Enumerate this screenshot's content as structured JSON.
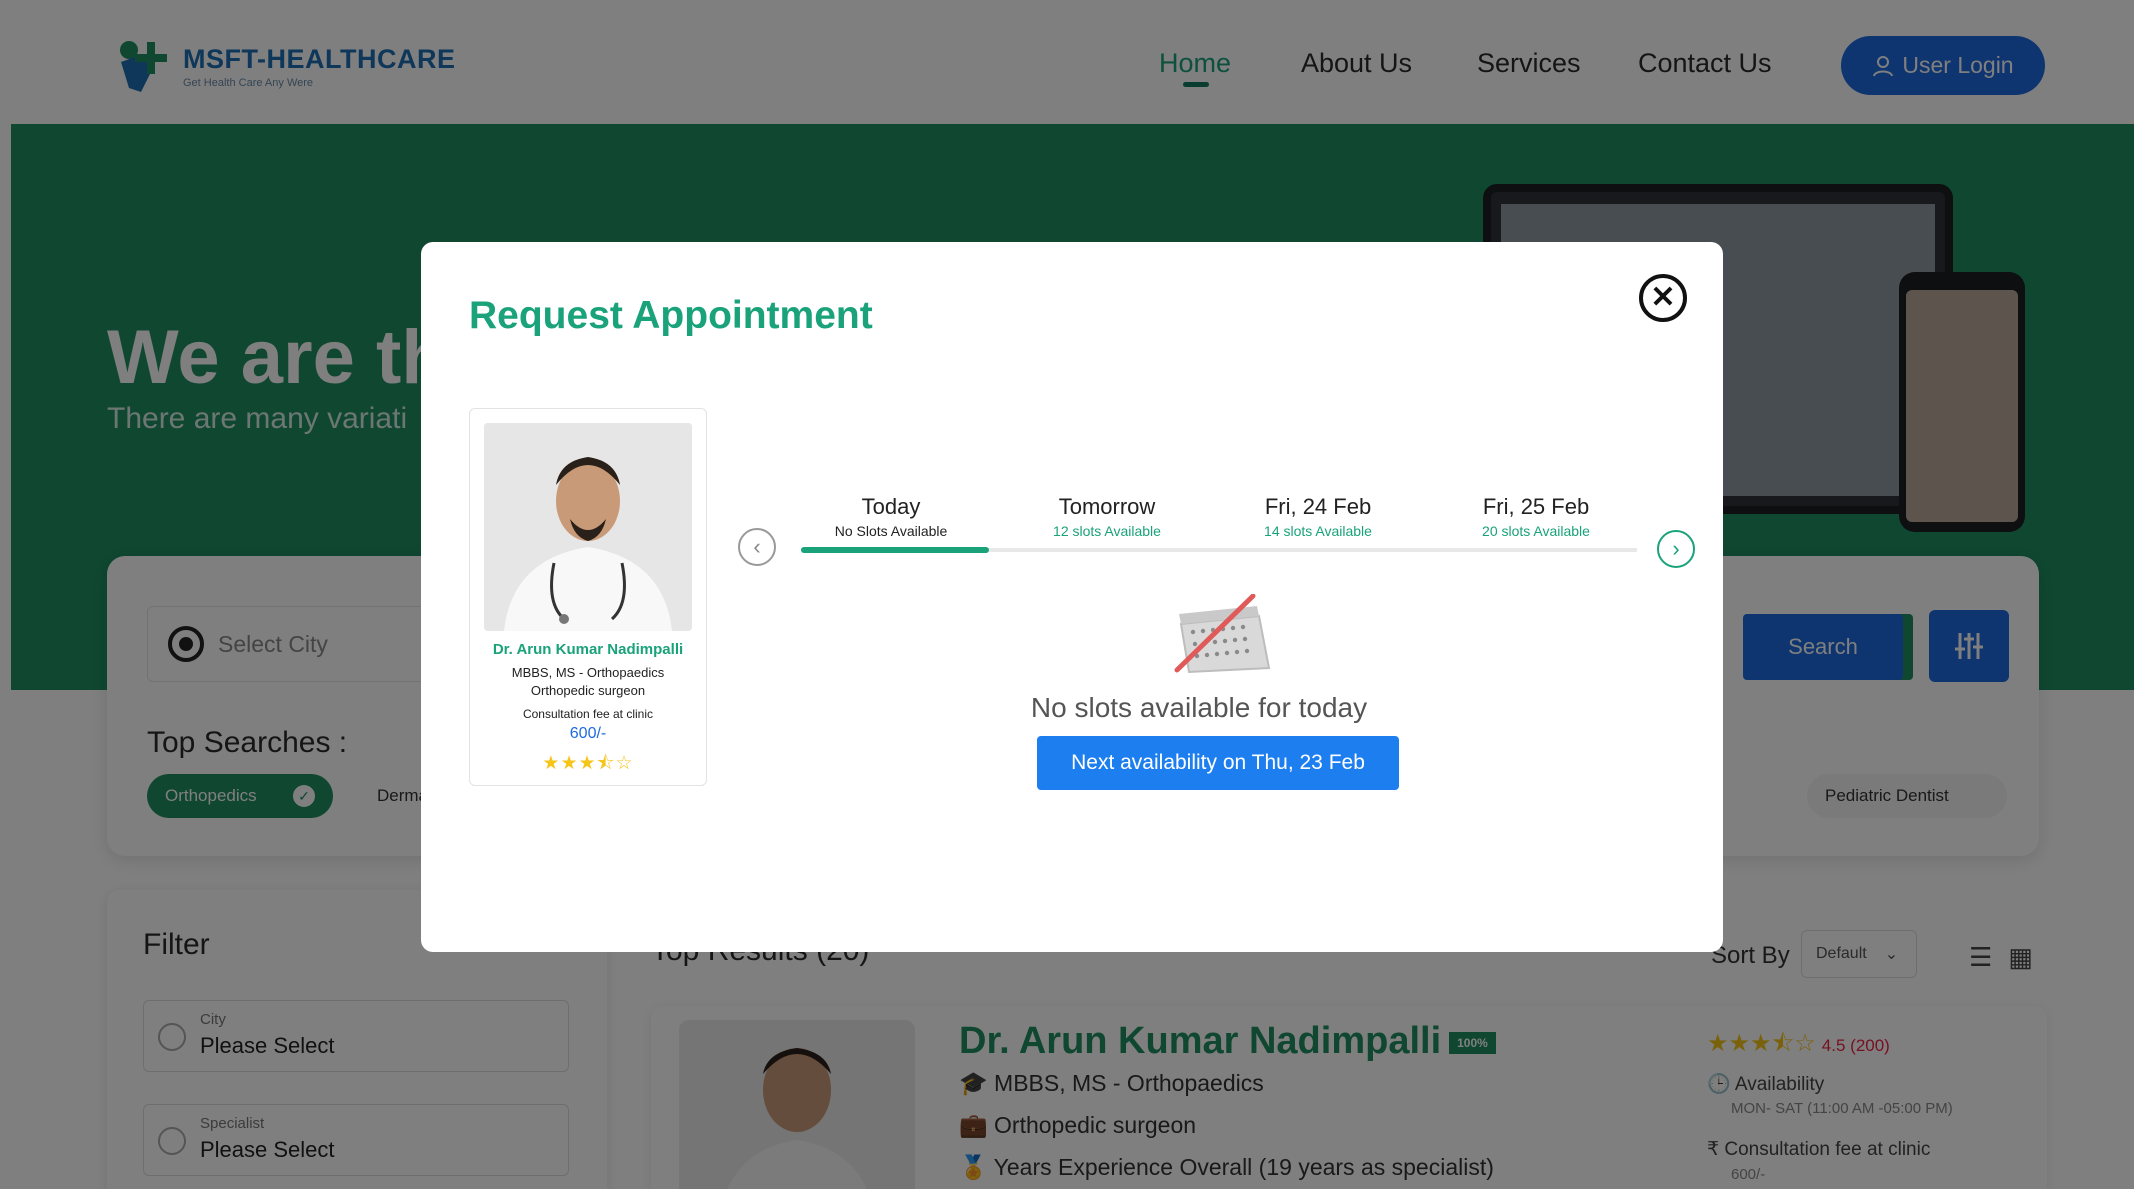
{
  "site": {
    "logo_title": "MSFT-HEALTHCARE",
    "logo_tagline": "Get Health Care Any Were",
    "nav": [
      "Home",
      "About Us",
      "Services",
      "Contact Us"
    ],
    "active_nav": "Home",
    "login_label": "User Login"
  },
  "hero": {
    "title": "We are th",
    "subtitle": "There are many variati"
  },
  "search": {
    "city_placeholder": "Select City",
    "search_label": "Search",
    "top_searches_label": "Top Searches :",
    "chips": [
      "Orthopedics",
      "Derma",
      "Pediatric Dentist"
    ]
  },
  "filter": {
    "title": "Filter",
    "fields": [
      {
        "label": "City",
        "value": "Please Select"
      },
      {
        "label": "Specialist",
        "value": "Please Select"
      }
    ]
  },
  "results": {
    "title": "Top Results (20)",
    "sort_by_label": "Sort By",
    "sort_value": "Default",
    "card": {
      "name": "Dr. Arun Kumar Nadimpalli",
      "badge": "100%",
      "degree": "MBBS, MS - Orthopaedics",
      "role": "Orthopedic surgeon",
      "experience": "Years Experience Overall (19 years as specialist)",
      "rating": "4.5 (200)",
      "availability_label": "Availability",
      "availability_value": "MON- SAT (11:00 AM -05:00 PM)",
      "fee_label": "Consultation fee at clinic",
      "fee_value": "600/-"
    }
  },
  "modal": {
    "title": "Request Appointment",
    "doctor": {
      "name": "Dr. Arun Kumar Nadimpalli",
      "degree": "MBBS, MS - Orthopaedics",
      "role": "Orthopedic surgeon",
      "fee_label": "Consultation fee at clinic",
      "fee": "600/-",
      "stars": "★★★⯪☆",
      "rating_value": 3.5
    },
    "days": [
      {
        "label": "Today",
        "slots": "No Slots Available",
        "available": false
      },
      {
        "label": "Tomorrow",
        "slots": "12 slots Available",
        "available": true
      },
      {
        "label": "Fri, 24 Feb",
        "slots": "14 slots Available",
        "available": true
      },
      {
        "label": "Fri, 25 Feb",
        "slots": "20 slots Available",
        "available": true
      }
    ],
    "empty_message": "No slots available for today",
    "next_availability": "Next availability on Thu, 23 Feb"
  },
  "colors": {
    "brand_green": "#1aa27a",
    "hero_green": "#1f8f62",
    "primary_blue": "#1d6ae0",
    "star_yellow": "#f5c518"
  }
}
